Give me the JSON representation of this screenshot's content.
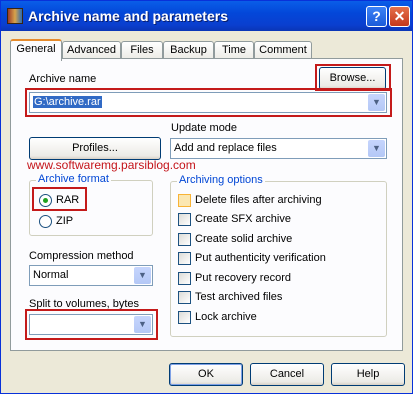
{
  "window": {
    "title": "Archive name and parameters",
    "help_glyph": "?",
    "close_glyph": "✕"
  },
  "tabs": [
    "General",
    "Advanced",
    "Files",
    "Backup",
    "Time",
    "Comment"
  ],
  "archive_name": {
    "label": "Archive name",
    "value": "G:\\archive.rar",
    "browse_label": "Browse..."
  },
  "profiles_label": "Profiles...",
  "update_mode": {
    "label": "Update mode",
    "value": "Add and replace files"
  },
  "watermark_text": "www.softwaremg.parsiblog.com",
  "archive_format": {
    "label": "Archive format",
    "options": [
      "RAR",
      "ZIP"
    ],
    "selected": "RAR"
  },
  "compression": {
    "label": "Compression method",
    "value": "Normal"
  },
  "split": {
    "label": "Split to volumes, bytes",
    "value": ""
  },
  "archiving_options": {
    "label": "Archiving options",
    "items": [
      {
        "label": "Delete files after archiving",
        "checked": false
      },
      {
        "label": "Create SFX archive",
        "checked": false
      },
      {
        "label": "Create solid archive",
        "checked": false
      },
      {
        "label": "Put authenticity verification",
        "checked": false
      },
      {
        "label": "Put recovery record",
        "checked": false
      },
      {
        "label": "Test archived files",
        "checked": false
      },
      {
        "label": "Lock archive",
        "checked": false
      }
    ]
  },
  "buttons": {
    "ok": "OK",
    "cancel": "Cancel",
    "help": "Help"
  },
  "colors": {
    "highlight_box": "#c41a1a",
    "title_bar": "#0a5ee8",
    "watermark": "#c4141a"
  }
}
